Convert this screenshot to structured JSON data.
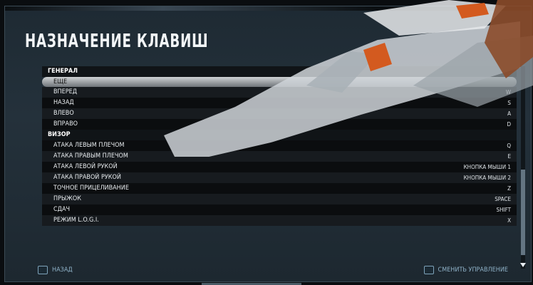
{
  "screen": {
    "title": "НАЗНАЧЕНИЕ КЛАВИШ"
  },
  "bindings": [
    {
      "label": "ГЕНЕРАЛ",
      "value": "",
      "type": "header"
    },
    {
      "label": "ЕЩЕ",
      "value": "",
      "type": "selected"
    },
    {
      "label": "ВПЕРЕД",
      "value": "W",
      "type": "item"
    },
    {
      "label": "НАЗАД",
      "value": "S",
      "type": "item"
    },
    {
      "label": "ВЛЕВО",
      "value": "A",
      "type": "item"
    },
    {
      "label": "ВПРАВО",
      "value": "D",
      "type": "item"
    },
    {
      "label": "ВИЗОР",
      "value": "",
      "type": "header"
    },
    {
      "label": "АТАКА ЛЕВЫМ ПЛЕЧОМ",
      "value": "Q",
      "type": "item"
    },
    {
      "label": "АТАКА ПРАВЫМ ПЛЕЧОМ",
      "value": "E",
      "type": "item"
    },
    {
      "label": "АТАКА ЛЕВОЙ РУКОЙ",
      "value": "КНОПКА МЫШИ 1",
      "type": "item"
    },
    {
      "label": "АТАКА ПРАВОЙ РУКОЙ",
      "value": "КНОПКА МЫШИ 2",
      "type": "item"
    },
    {
      "label": "ТОЧНОЕ ПРИЦЕЛИВАНИЕ",
      "value": "Z",
      "type": "item"
    },
    {
      "label": "ПРЫЖОК",
      "value": "SPACE",
      "type": "item"
    },
    {
      "label": "СДАЧ",
      "value": "SHIFT",
      "type": "item"
    },
    {
      "label": "РЕЖИМ L.O.G.I.",
      "value": "X",
      "type": "item"
    }
  ],
  "footer": {
    "back_label": "НАЗАД",
    "reset_label": "СМЕНИТЬ УПРАВЛЕНИЕ"
  },
  "icons": {
    "back": "key-icon",
    "reset": "key-icon",
    "scroll_down": "chevron-down-icon"
  }
}
